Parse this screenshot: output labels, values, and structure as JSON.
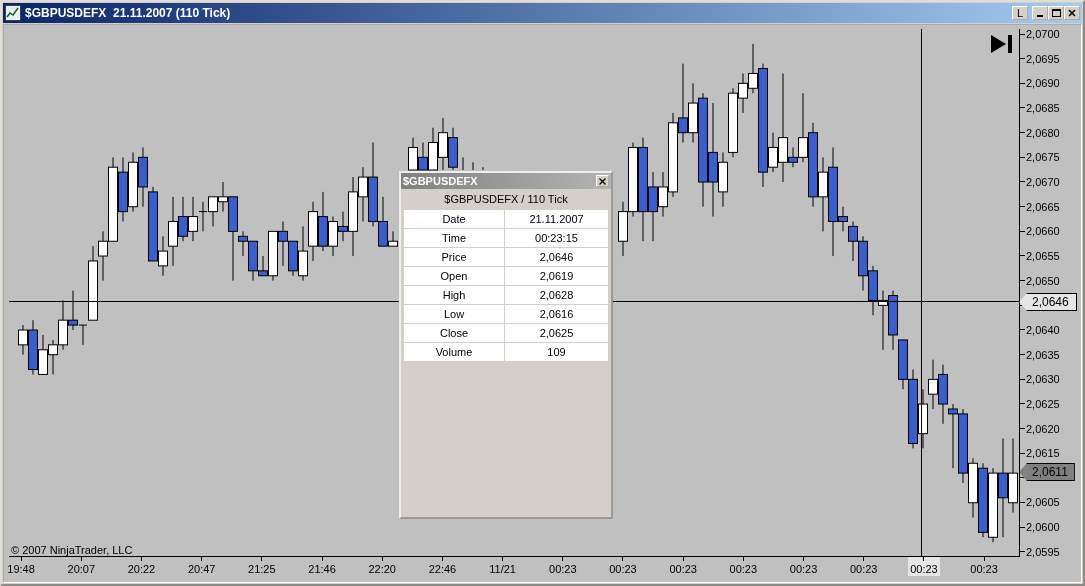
{
  "window": {
    "title": "$GBPUSDEFX  21.11.2007 (110 Tick)",
    "buttons": [
      "L"
    ]
  },
  "chart": {
    "y_axis_ticks": [
      {
        "kind": "label",
        "label": "2,0700"
      },
      {
        "kind": "label",
        "label": "2,0695"
      },
      {
        "kind": "label",
        "label": "2,0690"
      },
      {
        "kind": "label",
        "label": "2,0685"
      },
      {
        "kind": "label",
        "label": "2,0680"
      },
      {
        "kind": "label",
        "label": "2,0675"
      },
      {
        "kind": "label",
        "label": "2,0670"
      },
      {
        "kind": "label",
        "label": "2,0665"
      },
      {
        "kind": "label",
        "label": "2,0660"
      },
      {
        "kind": "label",
        "label": "2,0655"
      },
      {
        "kind": "label",
        "label": "2,0650"
      },
      {
        "kind": "covered"
      },
      {
        "kind": "label",
        "label": "2,0640"
      },
      {
        "kind": "label",
        "label": "2,0635"
      },
      {
        "kind": "label",
        "label": "2,0630"
      },
      {
        "kind": "label",
        "label": "2,0625"
      },
      {
        "kind": "label",
        "label": "2,0620"
      },
      {
        "kind": "label",
        "label": "2,0615"
      },
      {
        "kind": "covered"
      },
      {
        "kind": "label",
        "label": "2,0605"
      },
      {
        "kind": "label",
        "label": "2,0600"
      },
      {
        "kind": "label",
        "label": "2,0595"
      }
    ],
    "x_axis_labels": [
      {
        "label": "19:48",
        "highlighted": false
      },
      {
        "label": "20:07",
        "highlighted": false
      },
      {
        "label": "20:22",
        "highlighted": false
      },
      {
        "label": "20:47",
        "highlighted": false
      },
      {
        "label": "21:25",
        "highlighted": false
      },
      {
        "label": "21:46",
        "highlighted": false
      },
      {
        "label": "22:20",
        "highlighted": false
      },
      {
        "label": "22:46",
        "highlighted": false
      },
      {
        "label": "11/21",
        "highlighted": false
      },
      {
        "label": "00:23",
        "highlighted": false
      },
      {
        "label": "00:23",
        "highlighted": false
      },
      {
        "label": "00:23",
        "highlighted": false
      },
      {
        "label": "00:23",
        "highlighted": false
      },
      {
        "label": "00:23",
        "highlighted": false
      },
      {
        "label": "00:23",
        "highlighted": false
      },
      {
        "label": "00:23",
        "highlighted": true
      },
      {
        "label": "00:23",
        "highlighted": false
      }
    ],
    "price_markers": [
      {
        "kind": "cursor",
        "label": "2,0646"
      },
      {
        "kind": "last",
        "label": "2,0611"
      }
    ],
    "copyright": "© 2007 NinjaTrader, LLC"
  },
  "data_box": {
    "title": "$GBPUSDEFX",
    "header": "$GBPUSDEFX / 110 Tick",
    "rows": [
      {
        "label": "Date",
        "value": "21.11.2007"
      },
      {
        "label": "Time",
        "value": "00:23:15"
      },
      {
        "label": "Price",
        "value": "2,0646"
      },
      {
        "label": "Open",
        "value": "2,0619"
      },
      {
        "label": "High",
        "value": "2,0628"
      },
      {
        "label": "Low",
        "value": "2,0616"
      },
      {
        "label": "Close",
        "value": "2,0625"
      },
      {
        "label": "Volume",
        "value": "109"
      }
    ]
  }
}
